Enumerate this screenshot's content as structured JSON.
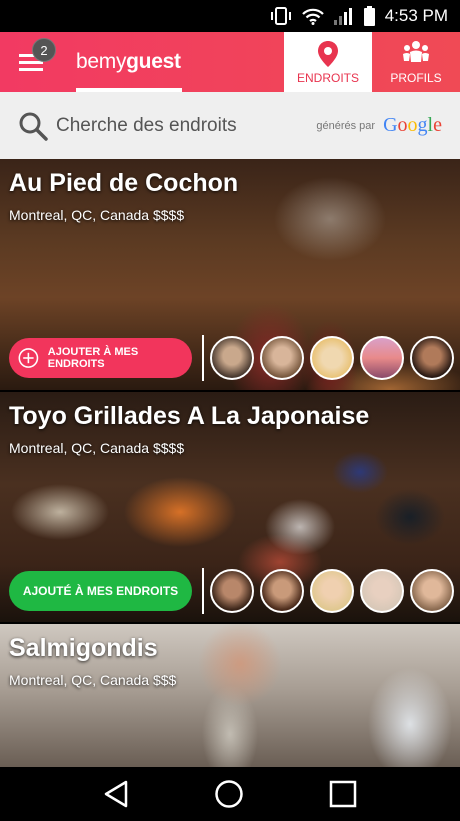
{
  "status_bar": {
    "time": "4:53 PM"
  },
  "header": {
    "menu_badge": "2",
    "logo_prefix": "bemy",
    "logo_suffix": "guest",
    "tabs": [
      {
        "label": "ENDROITS",
        "icon": "map-pin-icon",
        "active": true
      },
      {
        "label": "PROFILS",
        "icon": "people-icon",
        "active": false
      }
    ]
  },
  "search": {
    "placeholder": "Cherche des endroits",
    "powered_by": "générés par",
    "provider": "Google"
  },
  "places": [
    {
      "name": "Au Pied de Cochon",
      "location": "Montreal, QC, Canada $$$$",
      "action_label": "AJOUTER À MES ENDROITS",
      "action_state": "add",
      "avatars": [
        "avatar-1",
        "avatar-2",
        "avatar-3",
        "avatar-4",
        "avatar-5"
      ]
    },
    {
      "name": "Toyo Grillades A La Japonaise",
      "location": "Montreal, QC, Canada $$$$",
      "action_label": "AJOUTÉ À MES ENDROITS",
      "action_state": "added",
      "avatars": [
        "avatar-1",
        "avatar-2",
        "avatar-3",
        "avatar-4",
        "avatar-5"
      ]
    },
    {
      "name": "Salmigondis",
      "location": "Montreal, QC, Canada $$$"
    }
  ],
  "colors": {
    "brand": "#f23a62",
    "added": "#1fb843"
  }
}
